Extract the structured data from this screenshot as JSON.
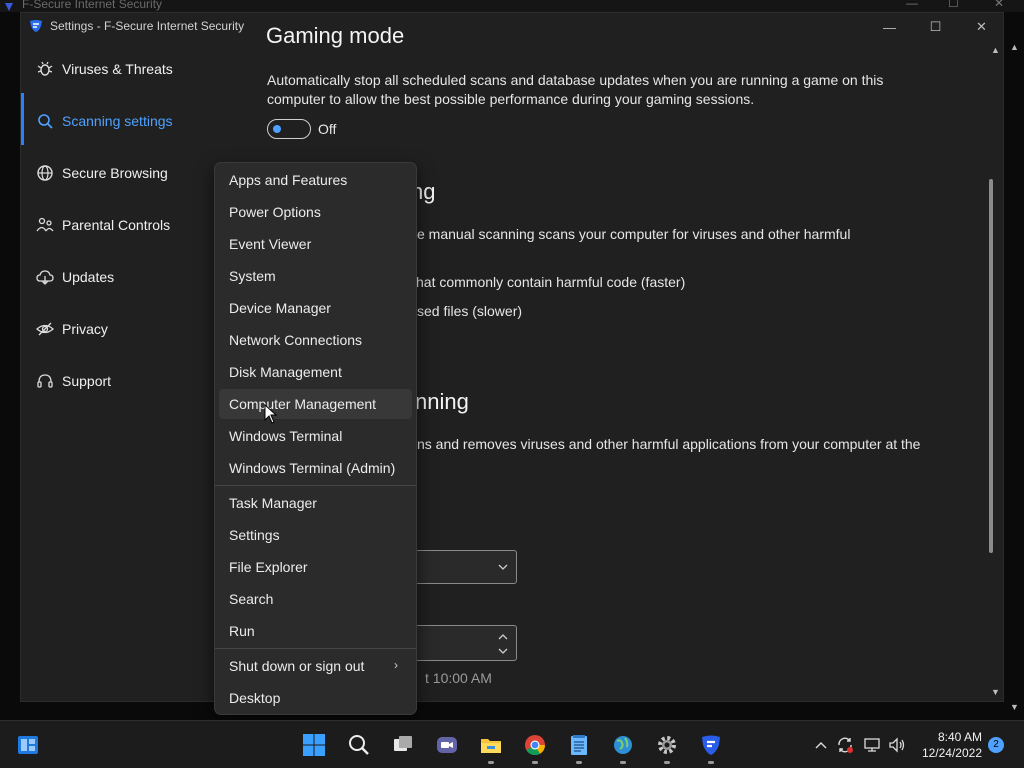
{
  "background_window": {
    "title": "F-Secure Internet Security"
  },
  "window": {
    "title": "Settings - F-Secure Internet Security",
    "controls": {
      "minimize": "—",
      "maximize": "☐",
      "close": "✕"
    }
  },
  "sidebar": {
    "items": [
      {
        "label": "Viruses & Threats",
        "icon": "bug-icon"
      },
      {
        "label": "Scanning settings",
        "icon": "search-icon",
        "active": true
      },
      {
        "label": "Secure Browsing",
        "icon": "globe-icon"
      },
      {
        "label": "Parental Controls",
        "icon": "family-icon"
      },
      {
        "label": "Updates",
        "icon": "cloud-icon"
      },
      {
        "label": "Privacy",
        "icon": "eye-off-icon"
      },
      {
        "label": "Support",
        "icon": "headset-icon"
      }
    ]
  },
  "content": {
    "gaming_heading": "Gaming mode",
    "gaming_desc_line1": "Automatically stop all scheduled scans and database updates when you are running a game on this",
    "gaming_desc_line2": "computer to allow the best possible performance during your gaming sessions.",
    "gaming_toggle_state": "Off",
    "manual_heading_visible": "ng",
    "manual_desc_visible": "e manual scanning scans your computer for viruses and other harmful",
    "option1_visible": "hat commonly contain harmful code (faster)",
    "option2_visible": "sed files (slower)",
    "scheduled_heading_visible": "nning",
    "scheduled_desc_visible": "ns and removes viruses and other harmful applications from your computer at the",
    "time_text_visible": "t 10:00 AM"
  },
  "context_menu": {
    "group1": [
      "Apps and Features",
      "Power Options",
      "Event Viewer",
      "System",
      "Device Manager",
      "Network Connections",
      "Disk Management",
      "Computer Management",
      "Windows Terminal",
      "Windows Terminal (Admin)"
    ],
    "group2": [
      "Task Manager",
      "Settings",
      "File Explorer",
      "Search",
      "Run"
    ],
    "group3": [
      "Shut down or sign out",
      "Desktop"
    ],
    "hovered": "Computer Management"
  },
  "taskbar": {
    "time": "8:40 AM",
    "date": "12/24/2022",
    "notifications": "2"
  },
  "colors": {
    "accent": "#4ea1ff",
    "window_bg": "#202020",
    "menu_bg": "#2b2b2b"
  }
}
